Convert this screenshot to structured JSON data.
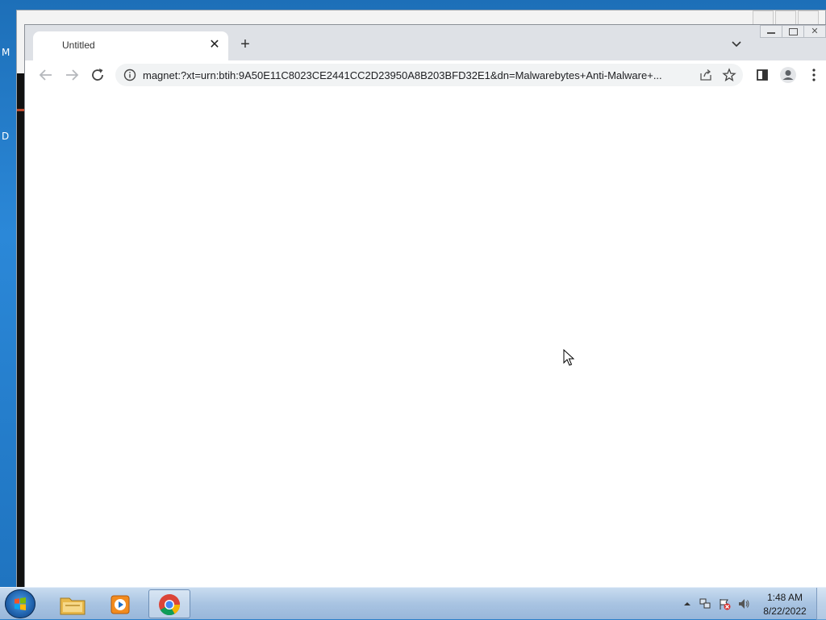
{
  "desktop": {
    "left_letters": [
      "M",
      "D"
    ]
  },
  "browser": {
    "tab": {
      "title": "Untitled"
    },
    "omnibox": {
      "url": "magnet:?xt=urn:btih:9A50E11C8023CE2441CC2D23950A8B203BFD32E1&dn=Malwarebytes+Anti-Malware+..."
    }
  },
  "taskbar": {
    "items": [
      "windows-explorer",
      "windows-media-player",
      "google-chrome"
    ],
    "clock": {
      "time": "1:48 AM",
      "date": "8/22/2022"
    }
  },
  "colors": {
    "tabstrip": "#dee1e6",
    "omnibox": "#f1f3f4",
    "taskbar": "#a9c4e2",
    "desktop": "#2b88d8"
  }
}
